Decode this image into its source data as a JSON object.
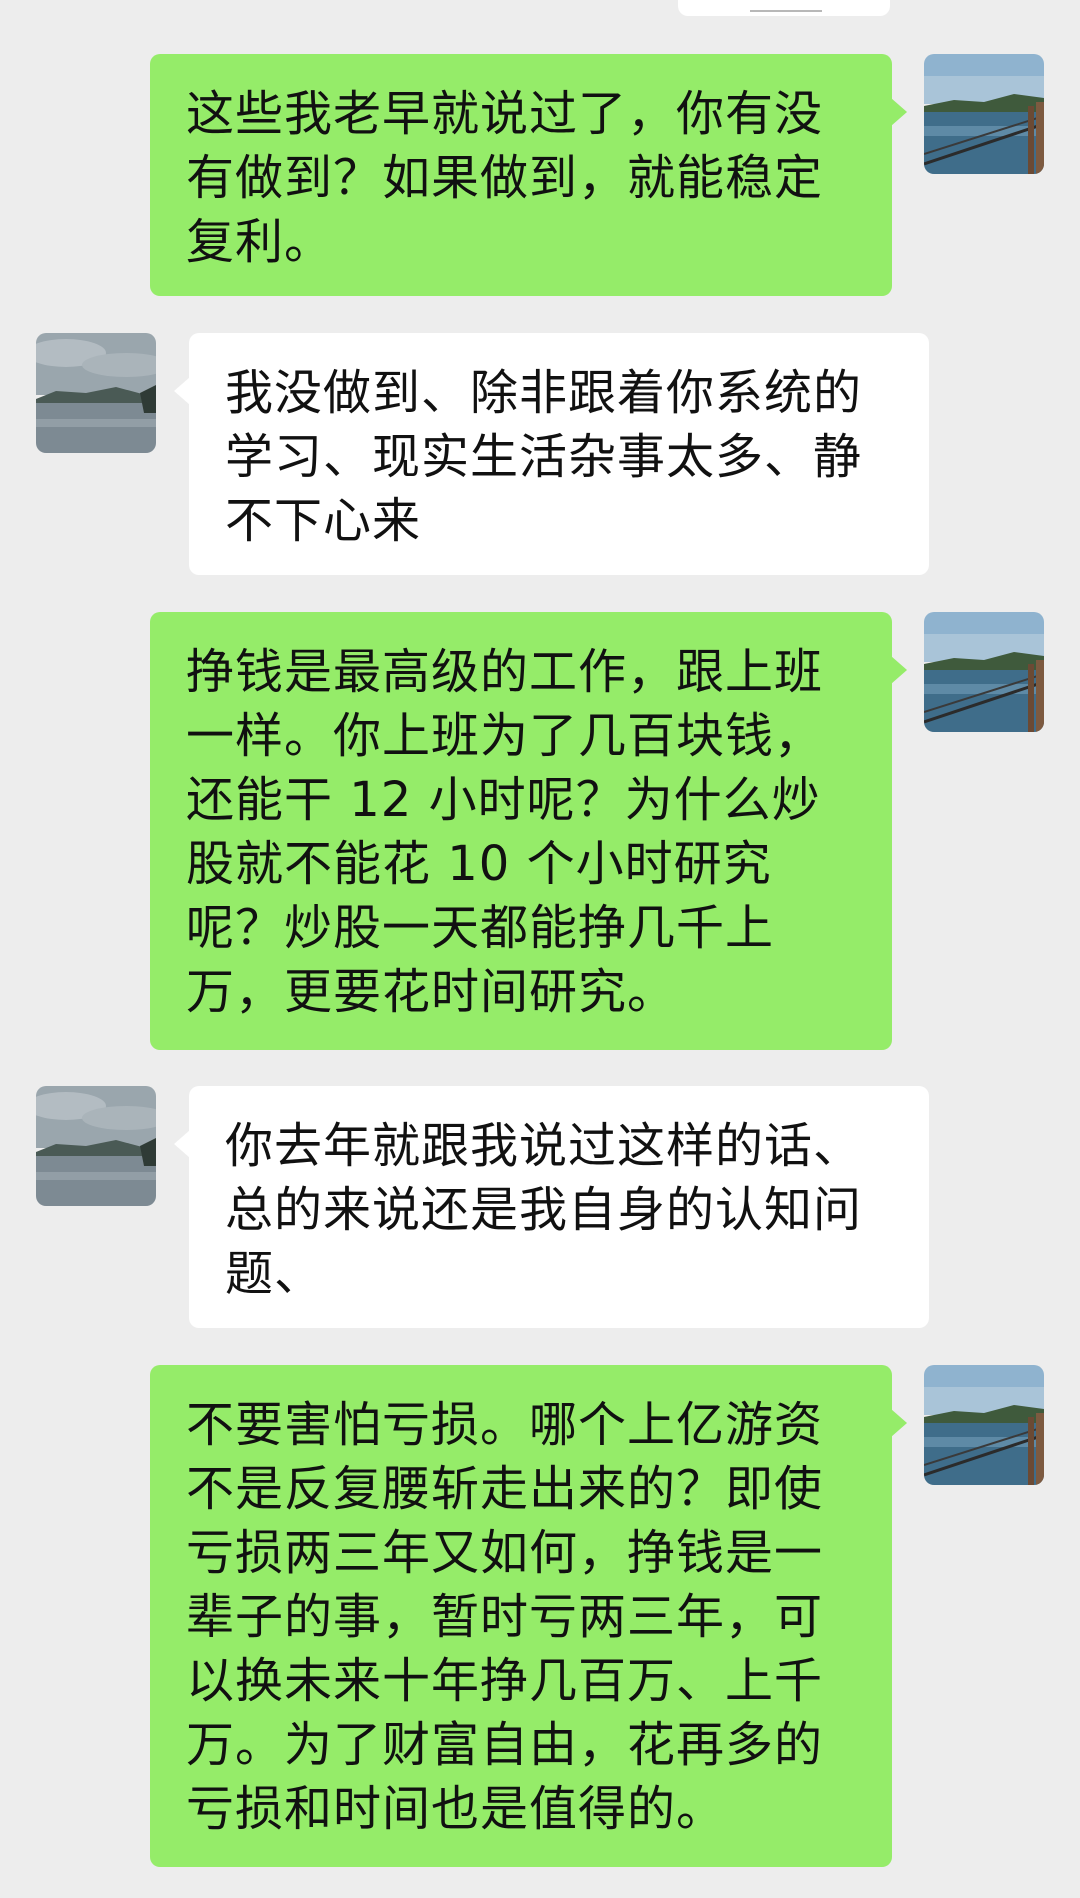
{
  "messages": [
    {
      "side": "right",
      "sender_avatar": "lakeside-railing-avatar",
      "text": "这些我老早就说过了，你有没有做到？如果做到，就能稳定复利。"
    },
    {
      "side": "left",
      "sender_avatar": "cloudy-lake-avatar",
      "text": "我没做到、除非跟着你系统的学习、现实生活杂事太多、静不下心来"
    },
    {
      "side": "right",
      "sender_avatar": "lakeside-railing-avatar",
      "text": "挣钱是最高级的工作，跟上班一样。你上班为了几百块钱，还能干 12 小时呢？为什么炒股就不能花 10 个小时研究呢？炒股一天都能挣几千上万，更要花时间研究。"
    },
    {
      "side": "left",
      "sender_avatar": "cloudy-lake-avatar",
      "text": "你去年就跟我说过这样的话、总的来说还是我自身的认知问题、"
    },
    {
      "side": "right",
      "sender_avatar": "lakeside-railing-avatar",
      "text": "不要害怕亏损。哪个上亿游资不是反复腰斩走出来的？即使亏损两三年又如何，挣钱是一辈子的事，暂时亏两三年，可以换未来十年挣几百万、上千万。为了财富自由，花再多的亏损和时间也是值得的。"
    }
  ],
  "colors": {
    "background": "#ededed",
    "sent_bubble": "#95ec69",
    "received_bubble": "#ffffff",
    "text": "#111111"
  }
}
